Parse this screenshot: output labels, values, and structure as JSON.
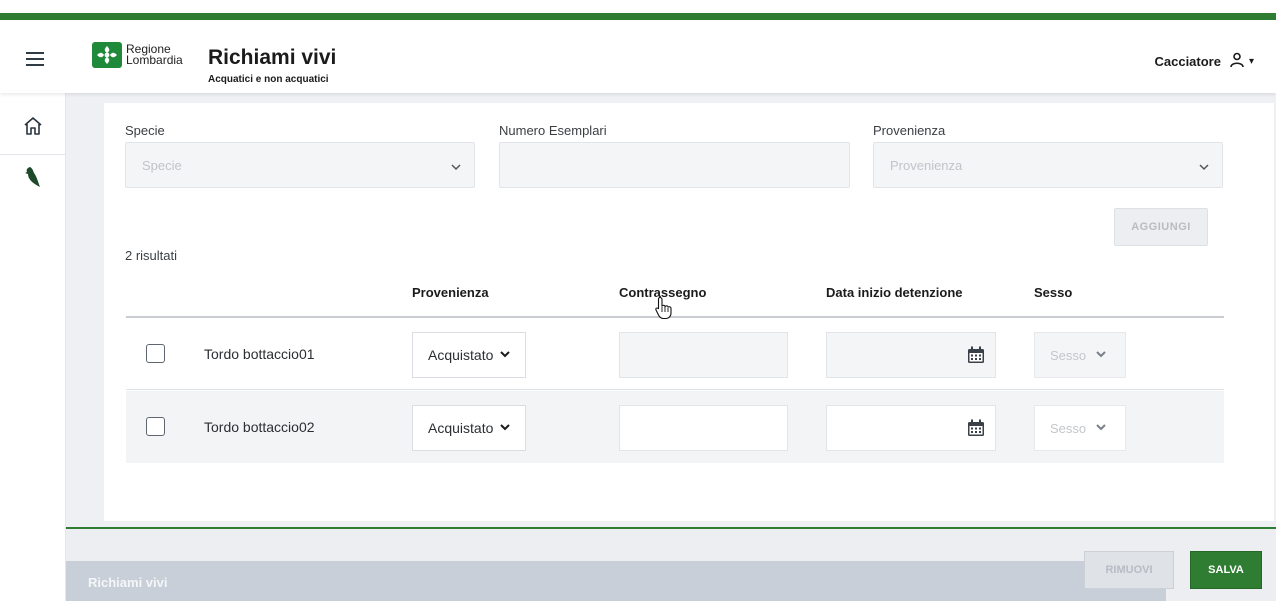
{
  "header": {
    "logo_text_line1": "Regione",
    "logo_text_line2": "Lombardia",
    "app_title": "Richiami vivi",
    "app_subtitle": "Acquatici e non acquatici",
    "user_label": "Cacciatore"
  },
  "sidebar": {
    "items": [
      {
        "icon": "home-icon"
      },
      {
        "icon": "bird-icon"
      }
    ]
  },
  "form": {
    "specie": {
      "label": "Specie",
      "placeholder": "Specie"
    },
    "numero_esemplari": {
      "label": "Numero Esemplari",
      "value": ""
    },
    "provenienza": {
      "label": "Provenienza",
      "placeholder": "Provenienza"
    },
    "add_button": "AGGIUNGI"
  },
  "results_count": "2 risultati",
  "table": {
    "columns": [
      "Provenienza",
      "Contrassegno",
      "Data inizio detenzione",
      "Sesso"
    ],
    "rows": [
      {
        "name": "Tordo bottaccio01",
        "provenienza": "Acquistato",
        "contrassegno": "",
        "data": "",
        "sesso": "Sesso"
      },
      {
        "name": "Tordo bottaccio02",
        "provenienza": "Acquistato",
        "contrassegno": "",
        "data": "",
        "sesso": "Sesso"
      }
    ]
  },
  "footer": {
    "title": "Richiami vivi",
    "remove_button": "RIMUOVI",
    "save_button": "SALVA"
  },
  "colors": {
    "brand_green": "#2e7d32",
    "disabled_gray": "#b8bcc2"
  }
}
